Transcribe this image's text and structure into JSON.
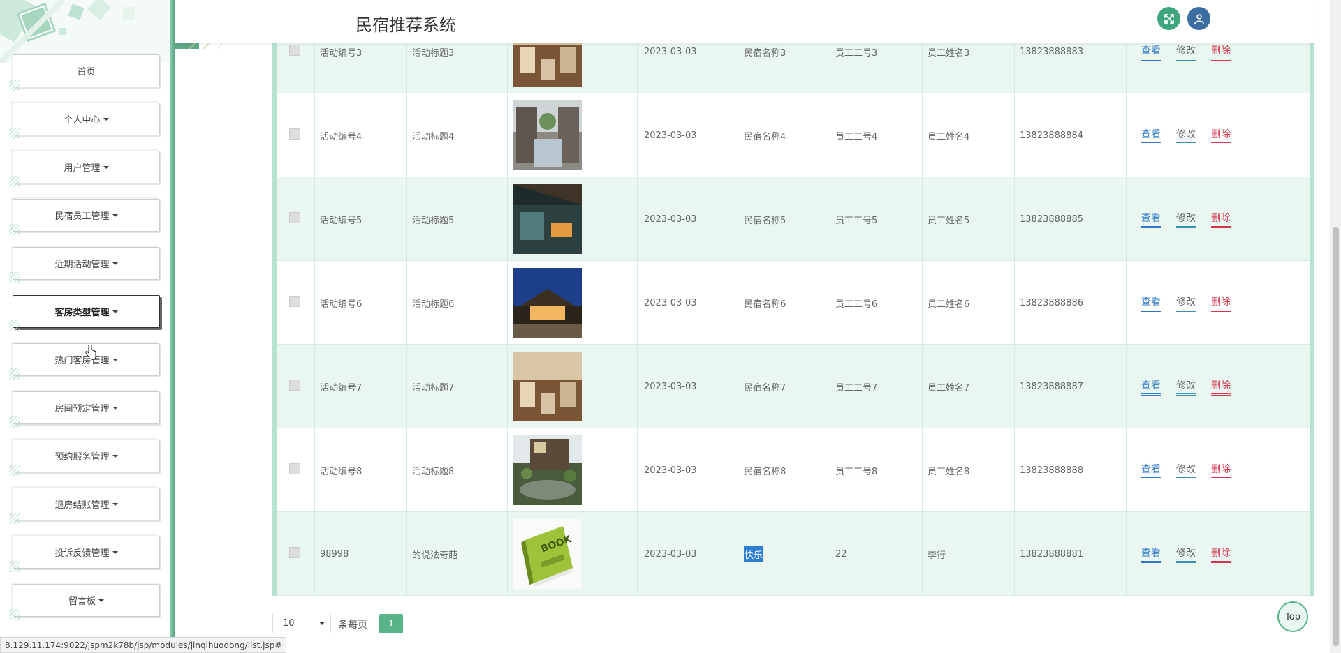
{
  "app": {
    "title": "民宿推荐系统"
  },
  "sidebar": {
    "items": [
      {
        "label": "首页",
        "dropdown": false
      },
      {
        "label": "个人中心",
        "dropdown": true
      },
      {
        "label": "用户管理",
        "dropdown": true
      },
      {
        "label": "民宿员工管理",
        "dropdown": true
      },
      {
        "label": "近期活动管理",
        "dropdown": true
      },
      {
        "label": "客房类型管理",
        "dropdown": true,
        "active": true
      },
      {
        "label": "热门客房管理",
        "dropdown": true
      },
      {
        "label": "房间预定管理",
        "dropdown": true
      },
      {
        "label": "预约服务管理",
        "dropdown": true
      },
      {
        "label": "退房结账管理",
        "dropdown": true
      },
      {
        "label": "投诉反馈管理",
        "dropdown": true
      },
      {
        "label": "留言板",
        "dropdown": true
      }
    ]
  },
  "table": {
    "actions": {
      "view": "查看",
      "edit": "修改",
      "delete": "删除"
    },
    "rows": [
      {
        "code": "活动编号3",
        "title": "活动标题3",
        "image": "lodge-corridor",
        "date": "2023-03-03",
        "homestay": "民宿名称3",
        "staff_no": "员工工号3",
        "staff_name": "员工姓名3",
        "phone": "13823888883"
      },
      {
        "code": "活动编号4",
        "title": "活动标题4",
        "image": "courtyard-pool",
        "date": "2023-03-03",
        "homestay": "民宿名称4",
        "staff_no": "员工工号4",
        "staff_name": "员工姓名4",
        "phone": "13823888884"
      },
      {
        "code": "活动编号5",
        "title": "活动标题5",
        "image": "night-terrace",
        "date": "2023-03-03",
        "homestay": "民宿名称5",
        "staff_no": "员工工号5",
        "staff_name": "员工姓名5",
        "phone": "13823888885"
      },
      {
        "code": "活动编号6",
        "title": "活动标题6",
        "image": "night-house",
        "date": "2023-03-03",
        "homestay": "民宿名称6",
        "staff_no": "员工工号6",
        "staff_name": "员工姓名6",
        "phone": "13823888886"
      },
      {
        "code": "活动编号7",
        "title": "活动标题7",
        "image": "lodge-corridor",
        "date": "2023-03-03",
        "homestay": "民宿名称7",
        "staff_no": "员工工号7",
        "staff_name": "员工姓名7",
        "phone": "13823888887"
      },
      {
        "code": "活动编号8",
        "title": "活动标题8",
        "image": "garden-pond",
        "date": "2023-03-03",
        "homestay": "民宿名称8",
        "staff_no": "员工工号8",
        "staff_name": "员工姓名8",
        "phone": "13823888888"
      },
      {
        "code": "98998",
        "title": "的说法奇葩",
        "image": "book",
        "date": "2023-03-03",
        "homestay": "快乐",
        "staff_no": "22",
        "staff_name": "李行",
        "phone": "13823888881",
        "highlight_homestay": true
      }
    ]
  },
  "pagination": {
    "page_size": "10",
    "per_page_label": "条每页",
    "current_page": "1"
  },
  "top_button": {
    "label": "Top"
  },
  "status_bar": {
    "url": "8.129.11.174:9022/jspm2k78b/jsp/modules/jinqihuodong/list.jsp#"
  },
  "colors": {
    "accent_green": "#59b388",
    "row_tint": "#eaf6f0",
    "view": "#2f77c7",
    "delete": "#d3364f"
  }
}
